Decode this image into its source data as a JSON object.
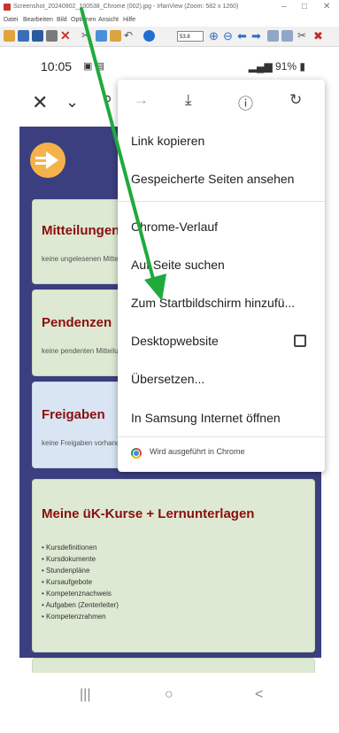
{
  "window": {
    "title": "Screenshot_20240902_100538_Chrome (002).jpg - IrfanView (Zoom: 582 x 1260)",
    "controls": [
      "–",
      "□",
      "✕"
    ],
    "menu": [
      "Datei",
      "Bearbeiten",
      "Bild",
      "Optionen",
      "Ansicht",
      "Hilfe"
    ],
    "zoom_value": "53.8"
  },
  "phone": {
    "time": "10:05",
    "status_right": "91%",
    "nav_buttons": [
      "|||",
      "○",
      "<"
    ]
  },
  "cards": [
    {
      "title": "Mitteilungen",
      "sub": "keine ungelesenen Mitteilungen"
    },
    {
      "title": "Pendenzen",
      "sub": "keine pendenten Mitteilungen"
    },
    {
      "title": "Freigaben",
      "sub": "keine Freigaben vorhanden"
    },
    {
      "title": "Meine üK-Kurse + Lernunterlagen",
      "items": [
        "Kursdefinitionen",
        "Kursdokumente",
        "Stundenpläne",
        "Kursaufgebote",
        "Kompetenznachweis",
        "Aufgaben (Zenterleiter)",
        "Kompetenzrahmen"
      ]
    }
  ],
  "menu": {
    "items": [
      "Link kopieren",
      "Gespeicherte Seiten ansehen",
      "Chrome-Verlauf",
      "Auf Seite suchen",
      "Zum Startbildschirm hinzufü...",
      "Desktopwebsite",
      "Übersetzen...",
      "In Samsung Internet öffnen"
    ],
    "footer": "Wird ausgeführt in Chrome"
  },
  "colors": {
    "arrow": "#1faa3c",
    "page_bg": "#3b3f7f",
    "card_title": "#8b0d0d"
  },
  "icons": [
    "forward-icon",
    "download-icon",
    "info-icon",
    "refresh-icon",
    "close-icon",
    "chevron-down-icon",
    "chrome-logo-icon"
  ]
}
